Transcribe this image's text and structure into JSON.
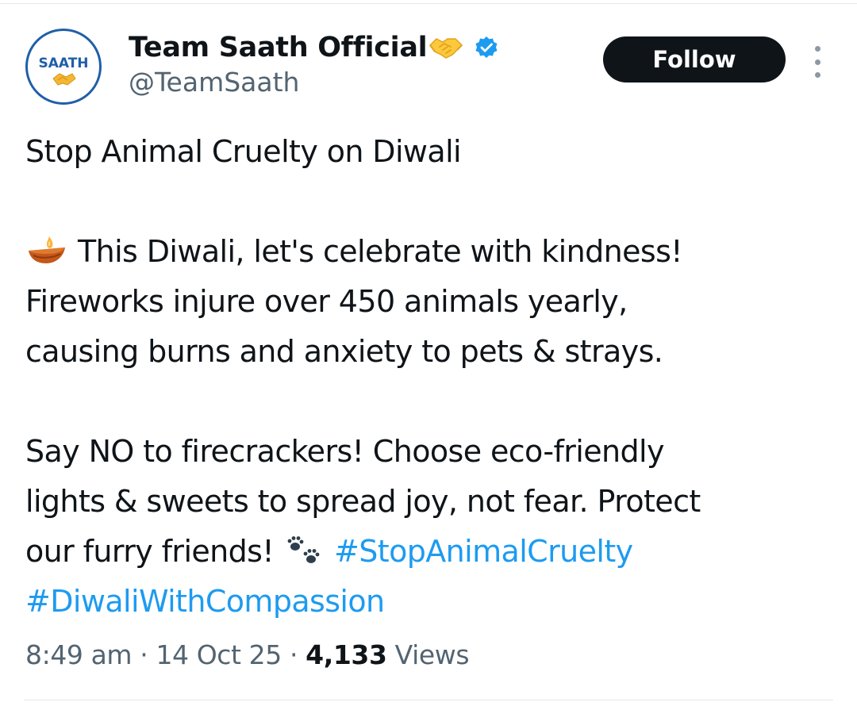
{
  "author": {
    "display_name": "Team Saath Official",
    "name_emoji": "handshake-emoji",
    "verified_icon": "verified-badge-icon",
    "handle": "@TeamSaath",
    "avatar_text": "SAATH"
  },
  "actions": {
    "follow_label": "Follow",
    "more_icon": "more-options-icon"
  },
  "tweet": {
    "line1": "Stop Animal Cruelty on Diwali",
    "para2": [
      "This Diwali, let's celebrate with kindness!",
      "Fireworks injure over 450 animals yearly,",
      "causing burns and anxiety to pets & strays."
    ],
    "para3": [
      "Say NO to firecrackers! Choose eco-friendly",
      "lights & sweets to spread joy, not fear. Protect",
      "our furry friends!"
    ],
    "hashtags": [
      "#StopAnimalCruelty",
      "#DiwaliWithCompassion"
    ]
  },
  "meta": {
    "time": "8:49 am",
    "separator": " · ",
    "date": "14 Oct 25",
    "views_count": "4,133",
    "views_label": " Views"
  },
  "colors": {
    "text": "#0f1419",
    "secondary": "#536471",
    "link": "#1d9bf0",
    "verified": "#1d9bf0",
    "follow_bg": "#0f1419",
    "avatar_ring": "#1f5fa8"
  }
}
